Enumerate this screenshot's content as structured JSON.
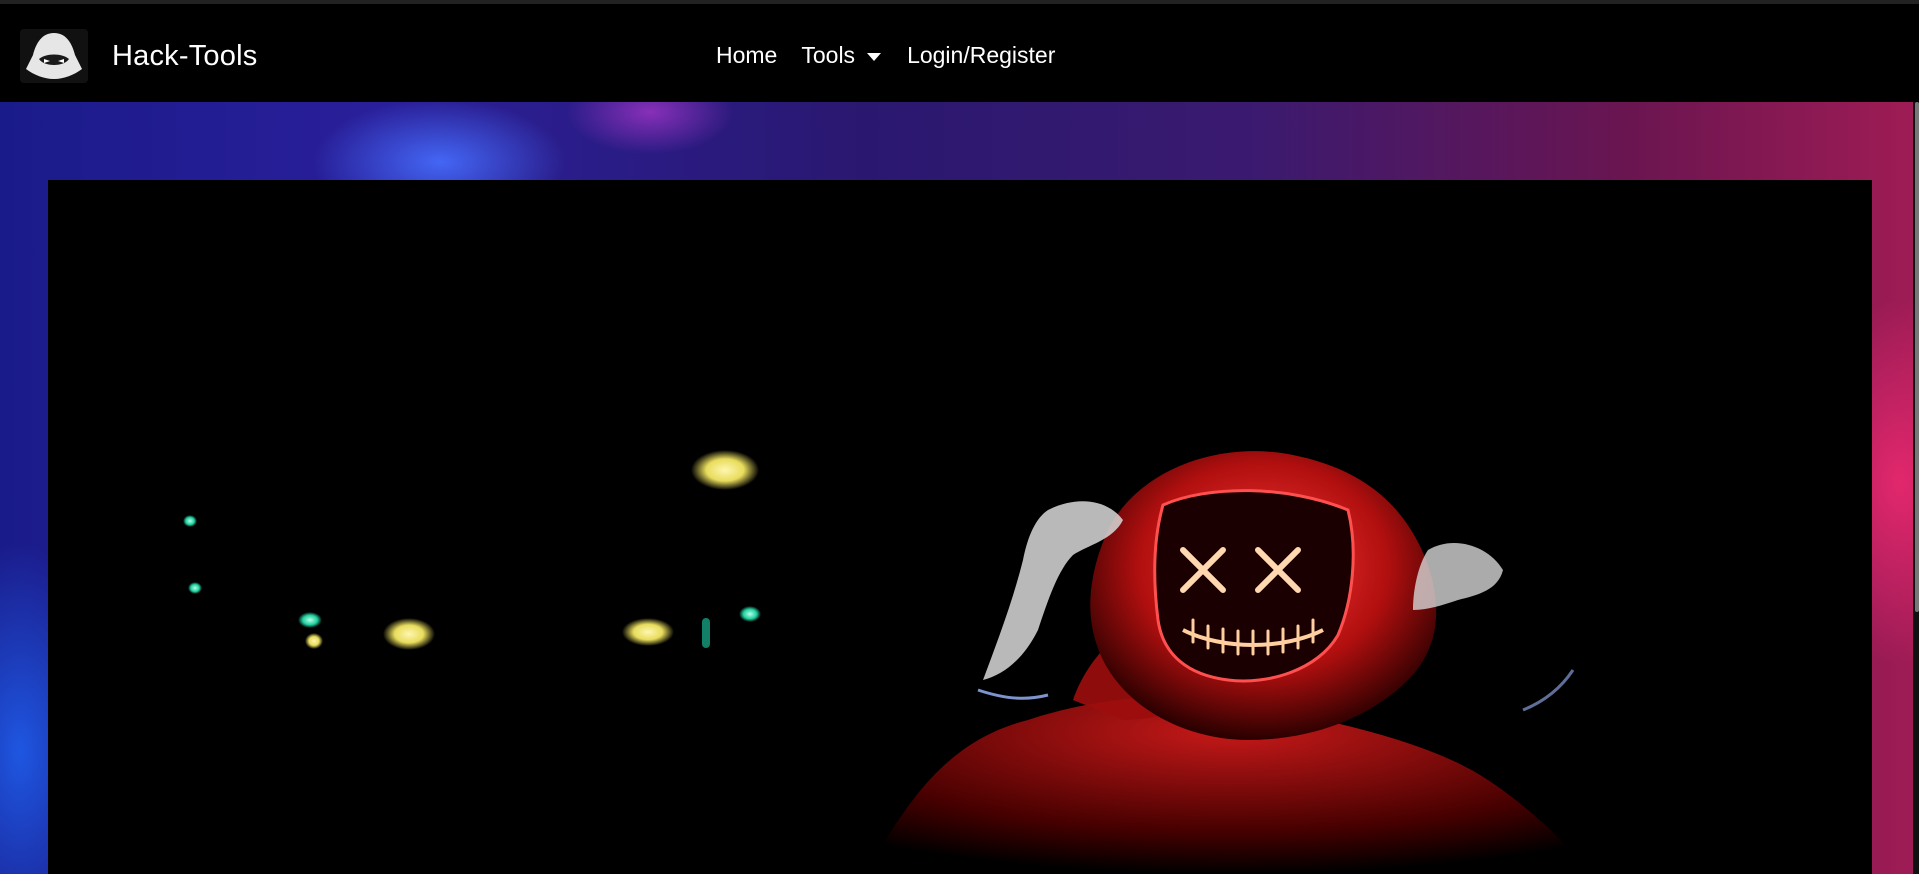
{
  "brand": {
    "name": "Hack-Tools",
    "logo_icon": "hacker-hood-icon"
  },
  "nav": {
    "items": [
      {
        "label": "Home"
      },
      {
        "label": "Tools",
        "icon": "caret-down-icon"
      },
      {
        "label": "Login/Register"
      }
    ]
  },
  "hero": {
    "image": "hooded-figure-with-neon-x-eyes-mask"
  },
  "colors": {
    "navbar_bg": "#000000",
    "text": "#ffffff",
    "bg_blue": "#1a1b8a",
    "bg_magenta": "#a01c55",
    "neon_red": "#ff2a2a",
    "neon_yellow": "#f1e36d",
    "neon_green": "#22d7a2"
  }
}
